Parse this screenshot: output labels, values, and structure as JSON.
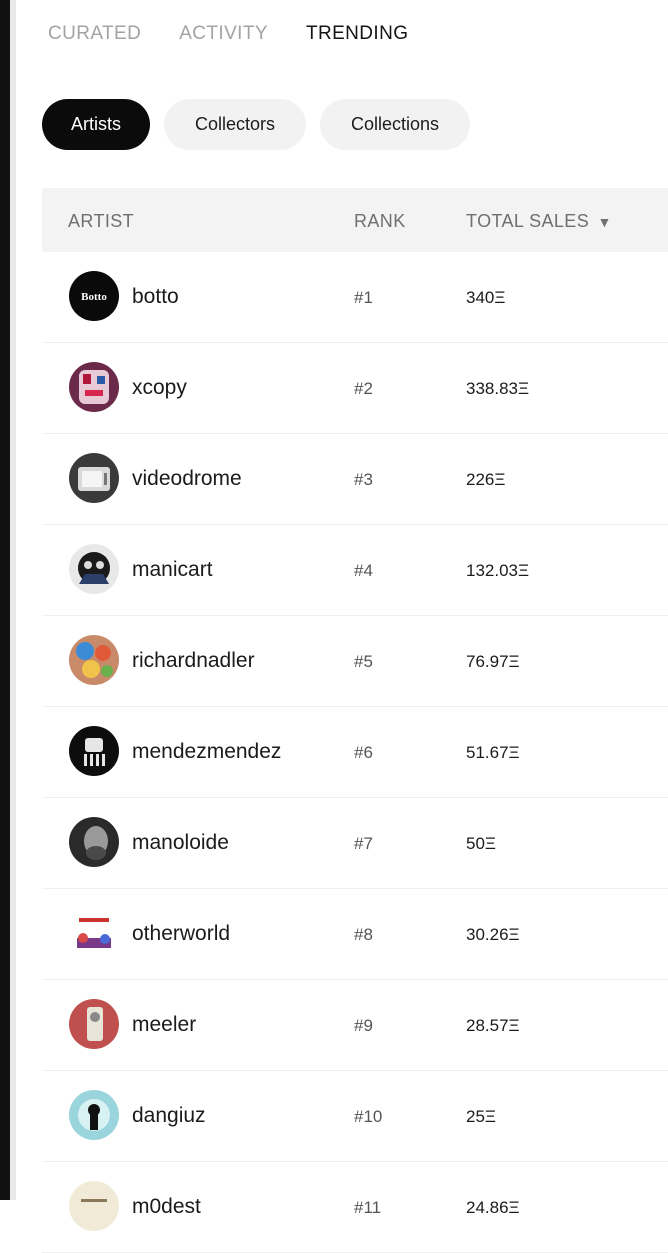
{
  "tabs": [
    "CURATED",
    "ACTIVITY",
    "TRENDING"
  ],
  "active_tab": "TRENDING",
  "filters": [
    "Artists",
    "Collectors",
    "Collections"
  ],
  "active_filter": "Artists",
  "table": {
    "headers": {
      "artist": "ARTIST",
      "rank": "RANK",
      "sales": "TOTAL SALES",
      "sort_indicator": "▼"
    },
    "rows": [
      {
        "name": "botto",
        "rank": "#1",
        "sales": "340Ξ",
        "avatar_text": "Botto"
      },
      {
        "name": "xcopy",
        "rank": "#2",
        "sales": "338.83Ξ"
      },
      {
        "name": "videodrome",
        "rank": "#3",
        "sales": "226Ξ"
      },
      {
        "name": "manicart",
        "rank": "#4",
        "sales": "132.03Ξ"
      },
      {
        "name": "richardnadler",
        "rank": "#5",
        "sales": "76.97Ξ"
      },
      {
        "name": "mendezmendez",
        "rank": "#6",
        "sales": "51.67Ξ"
      },
      {
        "name": "manoloide",
        "rank": "#7",
        "sales": "50Ξ"
      },
      {
        "name": "otherworld",
        "rank": "#8",
        "sales": "30.26Ξ"
      },
      {
        "name": "meeler",
        "rank": "#9",
        "sales": "28.57Ξ"
      },
      {
        "name": "dangiuz",
        "rank": "#10",
        "sales": "25Ξ"
      },
      {
        "name": "m0dest",
        "rank": "#11",
        "sales": "24.86Ξ"
      }
    ]
  }
}
